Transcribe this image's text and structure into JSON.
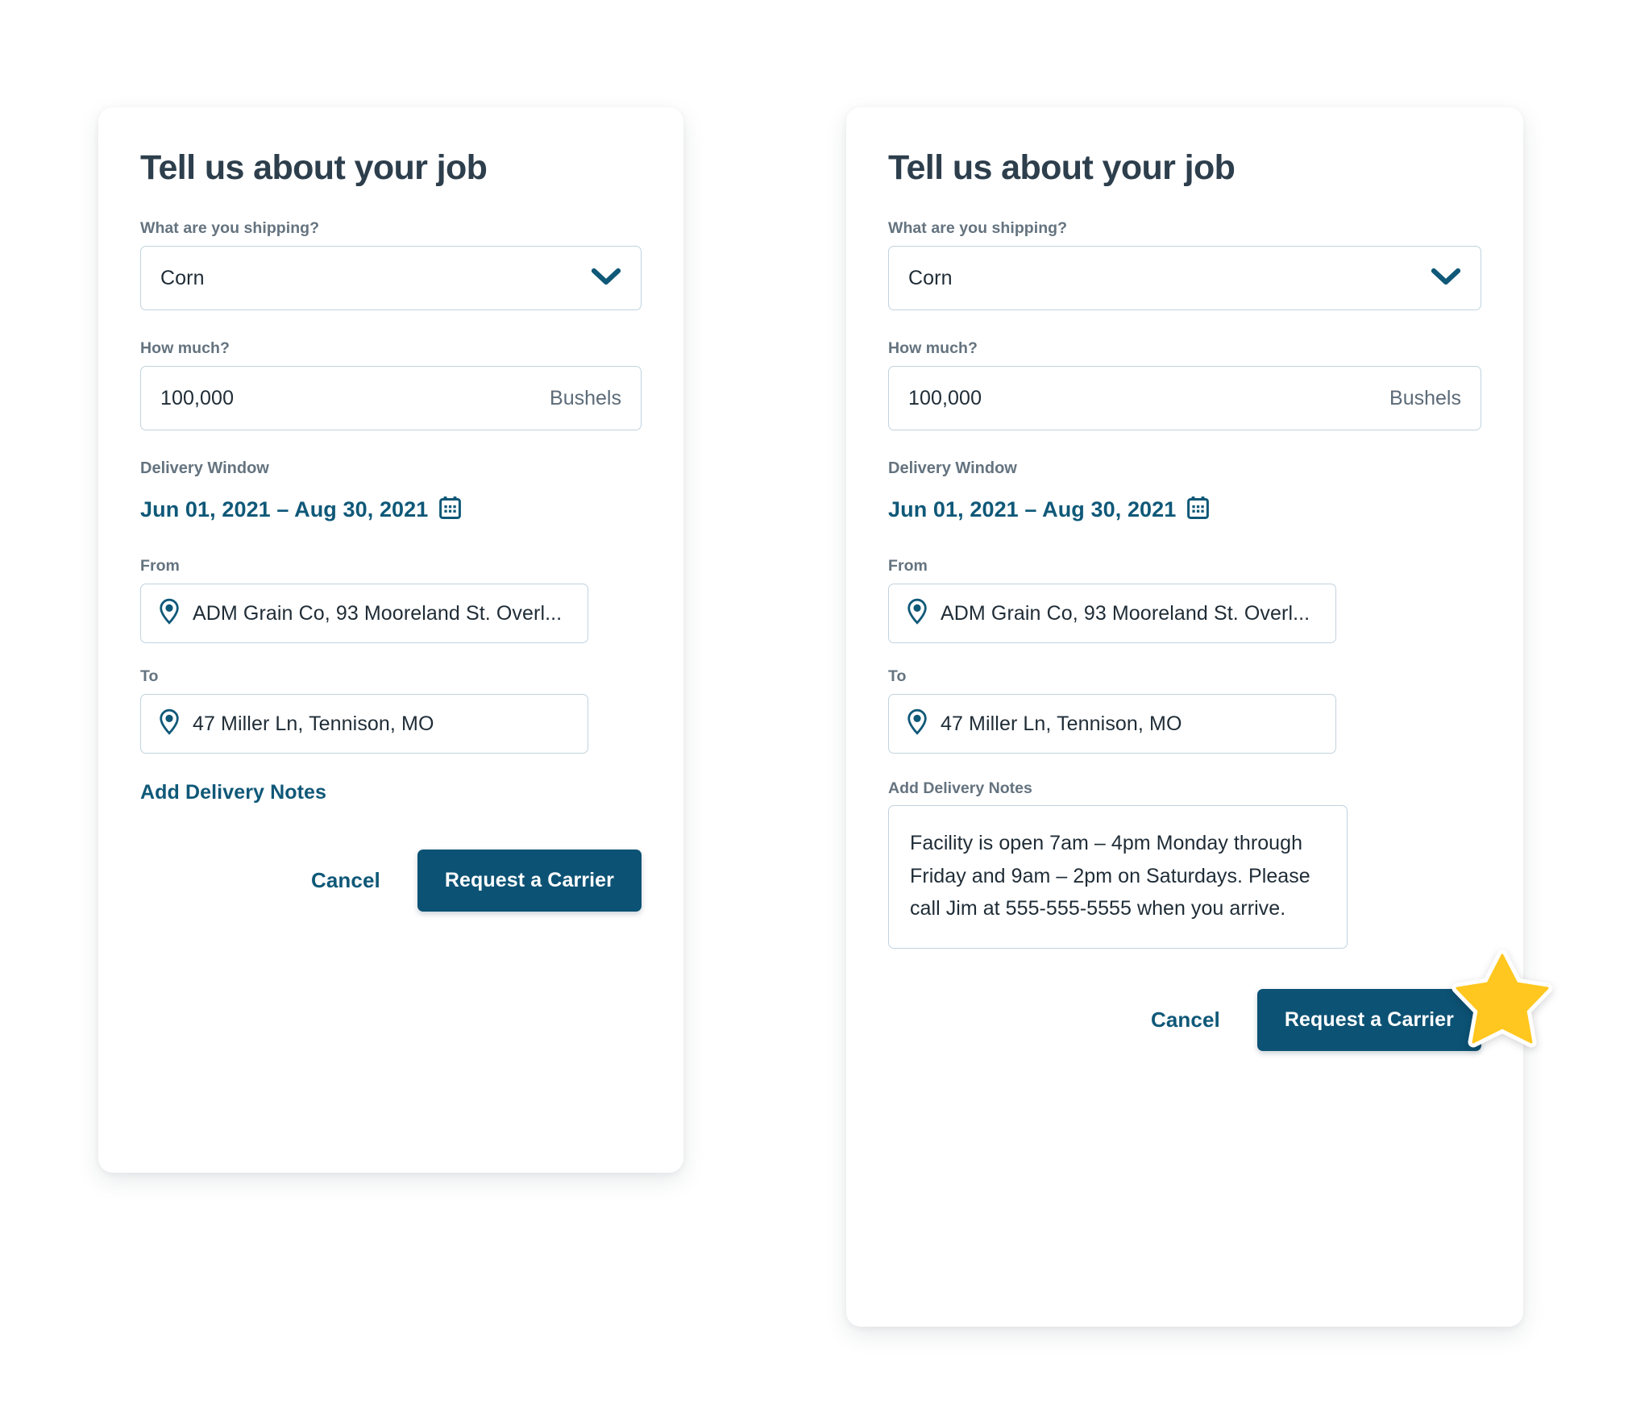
{
  "cards": [
    {
      "id": "left",
      "title": "Tell us about your job",
      "shipping": {
        "label": "What are you shipping?",
        "value": "Corn",
        "chevron_icon": "chevron-down-icon"
      },
      "amount": {
        "label": "How much?",
        "value": "100,000",
        "unit": "Bushels"
      },
      "delivery_window": {
        "label": "Delivery Window",
        "range": "Jun 01, 2021 – Aug 30, 2021",
        "calendar_icon": "calendar-icon"
      },
      "from": {
        "label": "From",
        "value": "ADM Grain Co, 93 Mooreland St. Overl...",
        "pin_icon": "location-pin-icon"
      },
      "to": {
        "label": "To",
        "value": "47 Miller Ln, Tennison, MO",
        "pin_icon": "location-pin-icon"
      },
      "notes": {
        "mode": "link",
        "link_label": "Add Delivery Notes"
      },
      "actions": {
        "cancel": "Cancel",
        "submit": "Request a Carrier"
      }
    },
    {
      "id": "right",
      "title": "Tell us about your job",
      "shipping": {
        "label": "What are you shipping?",
        "value": "Corn",
        "chevron_icon": "chevron-down-icon"
      },
      "amount": {
        "label": "How much?",
        "value": "100,000",
        "unit": "Bushels"
      },
      "delivery_window": {
        "label": "Delivery Window",
        "range": "Jun 01, 2021 – Aug 30, 2021",
        "calendar_icon": "calendar-icon"
      },
      "from": {
        "label": "From",
        "value": "ADM Grain Co, 93 Mooreland St. Overl...",
        "pin_icon": "location-pin-icon"
      },
      "to": {
        "label": "To",
        "value": "47 Miller Ln, Tennison, MO",
        "pin_icon": "location-pin-icon"
      },
      "notes": {
        "mode": "textarea",
        "label": "Add Delivery Notes",
        "value": "Facility is open 7am – 4pm Monday through Friday and 9am – 2pm on Saturdays. Please call Jim at 555-555-5555 when you arrive."
      },
      "actions": {
        "cancel": "Cancel",
        "submit": "Request a Carrier"
      }
    }
  ],
  "sticker": {
    "icon": "star-icon",
    "fill_color": "#FFC71F",
    "outline_color": "#FFFFFF"
  },
  "colors": {
    "accent_blue": "#0f5878",
    "primary_button": "#0c5274",
    "label_gray": "#64737f",
    "text_dark": "#2d3e4c",
    "border": "#c2d3de",
    "page_background": "#ffffff"
  }
}
